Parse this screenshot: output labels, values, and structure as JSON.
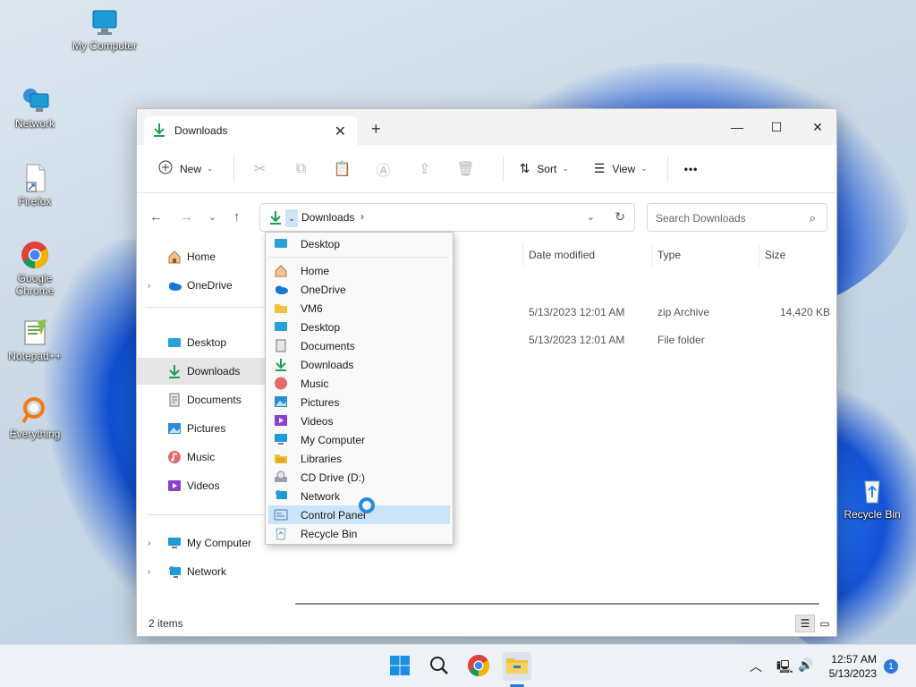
{
  "colors": {
    "accent": "#2b7bd6",
    "selection": "#cce4f7",
    "download_green": "#1f9d55",
    "folder_yellow": "#f2c13a"
  },
  "desktop": {
    "icons": [
      {
        "label": "My Computer",
        "icon": "monitor-icon"
      },
      {
        "label": "Network",
        "icon": "network-icon"
      },
      {
        "label": "Firefox",
        "icon": "shortcut-file-icon"
      },
      {
        "label": "Google Chrome",
        "icon": "chrome-icon"
      },
      {
        "label": "Notepad++",
        "icon": "notepad-plus-plus-icon"
      },
      {
        "label": "Everything",
        "icon": "everything-search-icon"
      },
      {
        "label": "Recycle Bin",
        "icon": "recycle-bin-icon"
      }
    ]
  },
  "window": {
    "tab_title": "Downloads",
    "toolbar": {
      "new_label": "New",
      "sort_label": "Sort",
      "view_label": "View",
      "more_label": "•••"
    },
    "address": {
      "segment": "Downloads",
      "separator": "›"
    },
    "search_placeholder": "Search Downloads",
    "sidebar": {
      "home": "Home",
      "onedrive": "OneDrive",
      "desktop": "Desktop",
      "downloads": "Downloads",
      "documents": "Documents",
      "pictures": "Pictures",
      "music": "Music",
      "videos": "Videos",
      "my_computer": "My Computer",
      "network": "Network"
    },
    "columns": {
      "date_modified": "Date modified",
      "type": "Type",
      "size": "Size"
    },
    "rows": [
      {
        "date": "5/13/2023 12:01 AM",
        "type": "zip Archive",
        "size": "14,420 KB"
      },
      {
        "date": "5/13/2023 12:01 AM",
        "type": "File folder",
        "size": ""
      }
    ],
    "status": "2 items"
  },
  "dropdown": {
    "items": [
      {
        "label": "Desktop",
        "icon": "desktop-icon"
      },
      {
        "label": "Home",
        "icon": "home-icon"
      },
      {
        "label": "OneDrive",
        "icon": "onedrive-icon"
      },
      {
        "label": "VM6",
        "icon": "folder-icon"
      },
      {
        "label": "Desktop",
        "icon": "desktop-icon"
      },
      {
        "label": "Documents",
        "icon": "documents-icon"
      },
      {
        "label": "Downloads",
        "icon": "downloads-icon"
      },
      {
        "label": "Music",
        "icon": "music-icon"
      },
      {
        "label": "Pictures",
        "icon": "pictures-icon"
      },
      {
        "label": "Videos",
        "icon": "videos-icon"
      },
      {
        "label": "My Computer",
        "icon": "monitor-icon"
      },
      {
        "label": "Libraries",
        "icon": "libraries-icon"
      },
      {
        "label": "CD Drive (D:)",
        "icon": "cd-drive-icon"
      },
      {
        "label": "Network",
        "icon": "network-icon"
      },
      {
        "label": "Control Panel",
        "icon": "control-panel-icon",
        "highlighted": true
      },
      {
        "label": "Recycle Bin",
        "icon": "recycle-bin-icon"
      }
    ]
  },
  "taskbar": {
    "time": "12:57 AM",
    "date": "5/13/2023",
    "notification_count": "1"
  }
}
